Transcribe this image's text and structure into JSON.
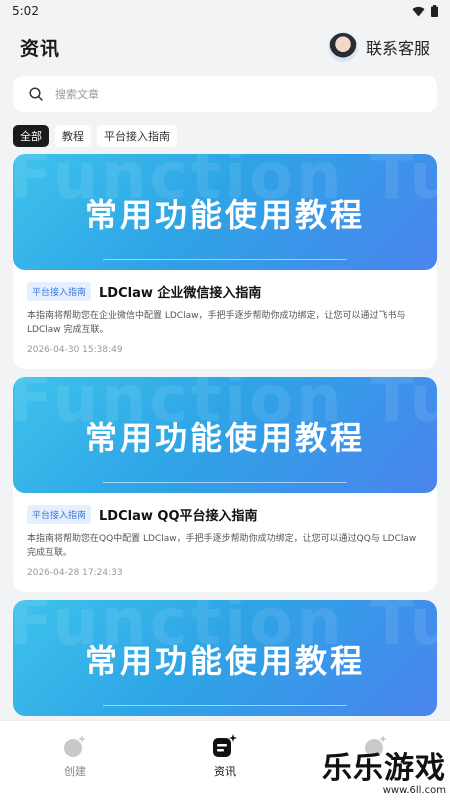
{
  "status_bar": {
    "time": "5:02",
    "wifi_icon": "wifi-icon",
    "battery_icon": "battery-icon"
  },
  "header": {
    "title": "资讯",
    "contact_label": "联系客服"
  },
  "search": {
    "placeholder": "搜索文章"
  },
  "tags": [
    {
      "label": "全部",
      "active": true
    },
    {
      "label": "教程",
      "active": false
    },
    {
      "label": "平台接入指南",
      "active": false
    }
  ],
  "banner": {
    "title": "常用功能使用教程",
    "bg_text": "Function Tutorials"
  },
  "articles": [
    {
      "badge": "平台接入指南",
      "title": "LDClaw 企业微信接入指南",
      "desc": "本指南将帮助您在企业微信中配置 LDClaw，手把手逐步帮助你成功绑定，让您可以通过飞书与LDClaw 完成互联。",
      "date": "2026-04-30 15:38:49"
    },
    {
      "badge": "平台接入指南",
      "title": "LDClaw QQ平台接入指南",
      "desc": "本指南将帮助您在QQ中配置 LDClaw，手把手逐步帮助你成功绑定，让您可以通过QQ与 LDClaw 完成互联。",
      "date": "2026-04-28 17:24:33"
    }
  ],
  "tabbar": {
    "tabs": [
      {
        "label": "创建",
        "icon": "create-icon",
        "active": false
      },
      {
        "label": "资讯",
        "icon": "news-icon",
        "active": true
      },
      {
        "label": "",
        "icon": "profile-icon",
        "active": false
      }
    ]
  },
  "watermark": {
    "main": "乐乐游戏",
    "sub": "www.6ll.com"
  }
}
